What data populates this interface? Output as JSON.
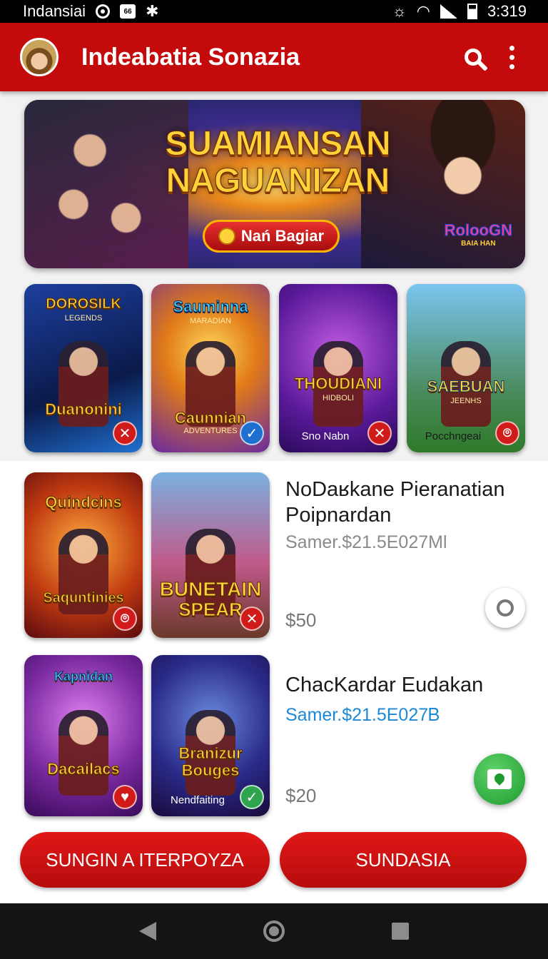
{
  "status_bar": {
    "carrier": "Indansiai",
    "badge": "66",
    "time": "3:319"
  },
  "app_bar": {
    "title": "Indeabatia Sonazia",
    "icons": [
      "avatar",
      "search-icon",
      "more-vert-icon"
    ]
  },
  "hero": {
    "title_line1": "SUAMIANSAN",
    "title_line2": "NAGUANIZAN",
    "cta_label": "Nań Bagiar",
    "logo_text": "RolooGN",
    "logo_sub": "BAIA HAN"
  },
  "game_row": [
    {
      "title": "DOROSILK",
      "subtitle": "LEGENDS",
      "caption": "Duanonini",
      "sub_caption": "",
      "footer": "",
      "badge": "close-icon",
      "badge_color": "#d11a1a"
    },
    {
      "title": "Sauminna",
      "subtitle": "MARADIAN",
      "caption": "Caunnian",
      "sub_caption": "ADVENTURES",
      "footer": "",
      "badge": "check-icon",
      "badge_color": "#1e6fd0"
    },
    {
      "title": "THOUDIANI",
      "subtitle": "HIDBOLI",
      "caption": "",
      "sub_caption": "",
      "footer": "Sno Nabn",
      "badge": "close-icon",
      "badge_color": "#d11a1a"
    },
    {
      "title": "SAEBUAN",
      "subtitle": "JEENHS",
      "caption": "",
      "sub_caption": "",
      "footer": "Pocchngeai",
      "badge": "pin-icon",
      "badge_color": "#d11a1a"
    }
  ],
  "list_items": [
    {
      "title_line1": "NoDaʁkane Pieranatian",
      "title_line2": "Poipnardan",
      "sub_price": "Samer.$21.5E027Ml",
      "sub_price_color": "#8a8a8a",
      "price": "$50",
      "cards": [
        {
          "title": "Quindcins",
          "caption": "Saquntinies",
          "badge": "pin-icon",
          "badge_color": "#d11a1a"
        },
        {
          "title": "BUNETAIN",
          "caption": "SPEAR",
          "badge": "close-icon",
          "badge_color": "#d11a1a"
        }
      ]
    },
    {
      "title_line1": "ChacKardar Eudakan",
      "title_line2": "",
      "sub_price": "Samer.$21.5E027Ᏼ",
      "sub_price_color": "#1a8ad6",
      "price": "$20",
      "cards": [
        {
          "title": "Kapnidan",
          "caption": "Dacailacs",
          "badge": "heart-icon",
          "badge_color": "#d11a1a"
        },
        {
          "title": "Branizur",
          "caption": "Bouges",
          "footer": "Nendfaiting",
          "badge": "check-icon",
          "badge_color": "#2ea44f"
        }
      ]
    }
  ],
  "buttons": {
    "left": "SUNGIN A ITERPOYZA",
    "right": "SUNDASIA"
  },
  "colors": {
    "primary": "#c40a0a",
    "accent_blue": "#1a8ad6",
    "fab_green": "#2ea44f"
  }
}
